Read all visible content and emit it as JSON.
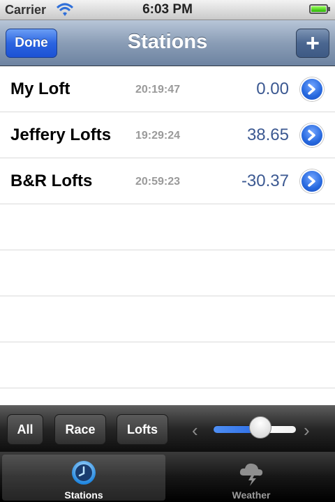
{
  "status_bar": {
    "carrier": "Carrier",
    "time": "6:03 PM",
    "battery_level": 1.0
  },
  "navbar": {
    "title": "Stations",
    "done_label": "Done",
    "add_label": "+"
  },
  "stations": [
    {
      "name": "My Loft",
      "time": "20:19:47",
      "value": "0.00"
    },
    {
      "name": "Jeffery Lofts",
      "time": "19:29:24",
      "value": "38.65"
    },
    {
      "name": "B&R Lofts",
      "time": "20:59:23",
      "value": "-30.37"
    }
  ],
  "toolbar": {
    "buttons": [
      {
        "label": "All"
      },
      {
        "label": "Race"
      },
      {
        "label": "Lofts"
      }
    ],
    "prev_label": "‹",
    "next_label": "›",
    "slider_value": 0.57
  },
  "tabbar": {
    "tabs": [
      {
        "label": "Stations",
        "icon": "clock-icon",
        "selected": true
      },
      {
        "label": "Weather",
        "icon": "cloud-lightning-icon",
        "selected": false
      }
    ]
  },
  "colors": {
    "value_blue": "#3b5891",
    "nav_blue": "#6d83a1",
    "done_blue": "#2b64e0"
  }
}
